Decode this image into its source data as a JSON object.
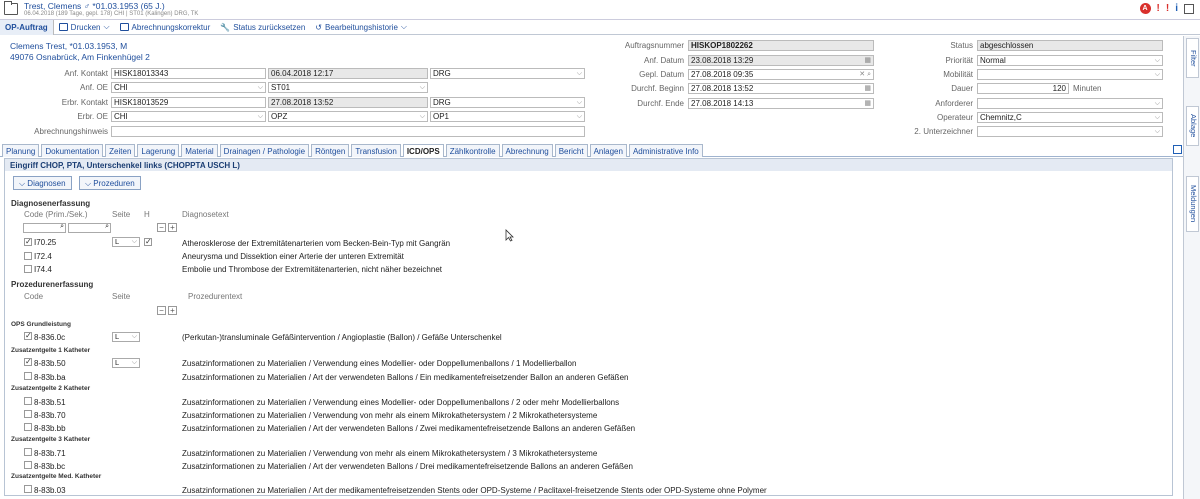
{
  "header": {
    "patient": "Trest, Clemens ♂ *01.03.1953 (65 J.)",
    "info": "06.04.2018 (189 Tage, gepl. 178)  CHI | ST01 (Kalingen)  DRG, TK"
  },
  "toolbar": {
    "op": "OP-Auftrag",
    "print": "Drucken",
    "abr": "Abrechnungskorrektur",
    "reset": "Status zurücksetzen",
    "hist": "Bearbeitungshistorie"
  },
  "form": {
    "name": "Clemens Trest, *01.03.1953, M",
    "addr": "49076 Osnabrück, Am Finkenhügel 2",
    "anf_kontakt_l": "Anf. Kontakt",
    "anf_kontakt": "HISK18013343",
    "anf_date": "06.04.2018 12:17",
    "anf_drg": "DRG",
    "anf_oe_l": "Anf. OE",
    "anf_oe": "CHI",
    "anf_st": "ST01",
    "erbr_kontakt_l": "Erbr. Kontakt",
    "erbr_kontakt": "HISK18013529",
    "erbr_date": "27.08.2018 13:52",
    "erbr_drg": "DRG",
    "erbr_oe_l": "Erbr. OE",
    "erbr_oe": "CHI",
    "erbr_opz": "OPZ",
    "erbr_op1": "OP1",
    "abr_l": "Abrechnungshinweis",
    "auftrag_l": "Auftragsnummer",
    "auftrag": "HISKOP1802262",
    "anfd_l": "Anf. Datum",
    "anfd": "23.08.2018 13:29",
    "gepl_l": "Gepl. Datum",
    "gepl": "27.08.2018 09:35",
    "db_l": "Durchf. Beginn",
    "db": "27.08.2018 13:52",
    "de_l": "Durchf. Ende",
    "de": "27.08.2018 14:13",
    "status_l": "Status",
    "status": "abgeschlossen",
    "prio_l": "Priorität",
    "prio": "Normal",
    "mob_l": "Mobilität",
    "dauer_l": "Dauer",
    "dauer": "120",
    "min": "Minuten",
    "anford_l": "Anforderer",
    "operat_l": "Operateur",
    "operat": "Chemnitz,C",
    "unter_l": "2. Unterzeichner"
  },
  "side": {
    "filter": "Filter",
    "ablage": "Ablage",
    "meldungen": "Meldungen"
  },
  "tabs": [
    "Planung",
    "Dokumentation",
    "Zeiten",
    "Lagerung",
    "Material",
    "Drainagen / Pathologie",
    "Röntgen",
    "Transfusion",
    "ICD/OPS",
    "Zählkontrolle",
    "Abrechnung",
    "Bericht",
    "Anlagen",
    "Administrative Info"
  ],
  "content": {
    "title": "Eingriff CHOP, PTA, Unterschenkel links (CHOPPTA USCH L)",
    "btn_diag": "Diagnosen",
    "btn_proz": "Prozeduren",
    "diag_h": "Diagnosenerfassung",
    "col_code": "Code (Prim./Sek.)",
    "col_seite": "Seite",
    "col_h": "H",
    "col_dtext": "Diagnosetext",
    "diag": [
      {
        "code": "I70.25",
        "seite": "L",
        "text": "Atherosklerose der Extremitätenarterien vom Becken-Bein-Typ mit Gangrän"
      },
      {
        "code": "I72.4",
        "text": "Aneurysma und Dissektion einer Arterie der unteren Extremität"
      },
      {
        "code": "I74.4",
        "text": "Embolie und Thrombose der Extremitätenarterien, nicht näher bezeichnet"
      }
    ],
    "proz_h": "Prozedurenerfassung",
    "col_code2": "Code",
    "col_seite2": "Seite",
    "col_ptext": "Prozedurentext",
    "g1": "OPS Grundleistung",
    "g2": "Zusatzentgelte 1 Katheter",
    "g3": "Zusatzentgelte 2 Katheter",
    "g4": "Zusatzentgelte 3 Katheter",
    "g5": "Zusatzentgelte Med. Katheter",
    "proz": [
      {
        "code": "8-836.0c",
        "seite": "L",
        "text": "(Perkutan-)transluminale Gefäßintervention / Angioplastie (Ballon) / Gefäße Unterschenkel"
      },
      {
        "code": "8-83b.50",
        "seite": "L",
        "text": "Zusatzinformationen zu Materialien / Verwendung eines Modellier- oder Doppellumenballons / 1 Modellierballon"
      },
      {
        "code": "8-83b.ba",
        "text": "Zusatzinformationen zu Materialien / Art der verwendeten Ballons / Ein medikamentefreisetzender Ballon an anderen Gefäßen"
      },
      {
        "code": "8-83b.51",
        "text": "Zusatzinformationen zu Materialien / Verwendung eines Modellier- oder Doppellumenballons / 2 oder mehr Modellierballons"
      },
      {
        "code": "8-83b.70",
        "text": "Zusatzinformationen zu Materialien / Verwendung von mehr als einem Mikrokathetersystem / 2 Mikrokathetersysteme"
      },
      {
        "code": "8-83b.bb",
        "text": "Zusatzinformationen zu Materialien / Art der verwendeten Ballons / Zwei medikamentefreisetzende Ballons an anderen Gefäßen"
      },
      {
        "code": "8-83b.71",
        "text": "Zusatzinformationen zu Materialien / Verwendung von mehr als einem Mikrokathetersystem / 3 Mikrokathetersysteme"
      },
      {
        "code": "8-83b.bc",
        "text": "Zusatzinformationen zu Materialien / Art der verwendeten Ballons / Drei medikamentefreisetzende Ballons an anderen Gefäßen"
      },
      {
        "code": "8-83b.03",
        "text": "Zusatzinformationen zu Materialien / Art der medikamentefreisetzenden Stents oder OPD-Systeme / Paclitaxel-freisetzende Stents oder OPD-Systeme ohne Polymer"
      }
    ]
  }
}
